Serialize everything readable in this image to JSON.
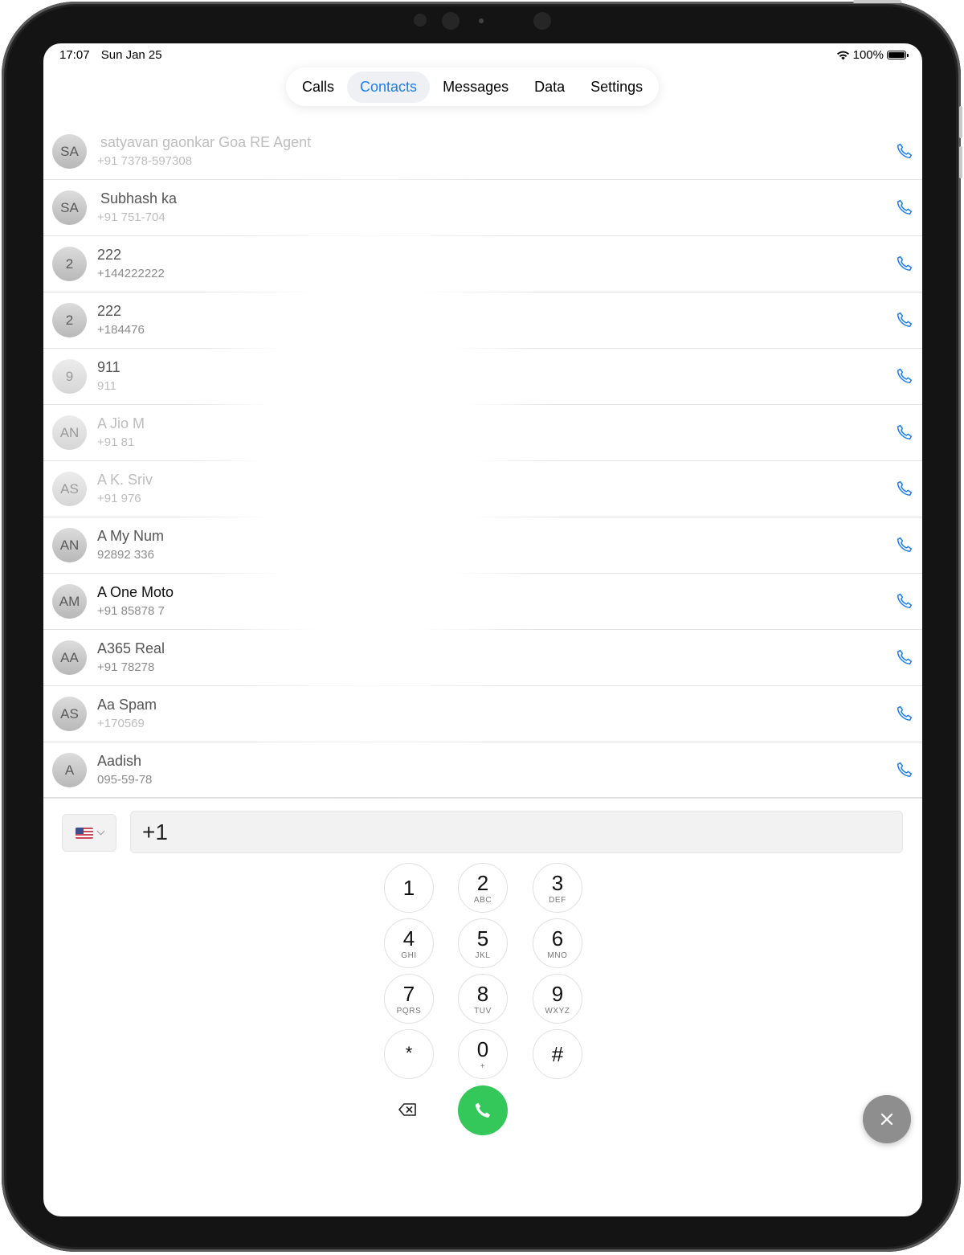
{
  "status_bar": {
    "time": "17:07",
    "date": "Sun Jan 25",
    "battery": "100%"
  },
  "tabs": [
    {
      "label": "Calls",
      "active": false
    },
    {
      "label": "Contacts",
      "active": true
    },
    {
      "label": "Messages",
      "active": false
    },
    {
      "label": "Data",
      "active": false
    },
    {
      "label": "Settings",
      "active": false
    }
  ],
  "contacts": [
    {
      "initials": "SA",
      "name": "satyavan gaonkar Goa RE Agent",
      "number": "+91 7378-597308"
    },
    {
      "initials": "SA",
      "name": "Subhash ka",
      "number": "+91 751-704"
    },
    {
      "initials": "2",
      "name": "222",
      "number": "+144222222"
    },
    {
      "initials": "2",
      "name": "222",
      "number": "+184476"
    },
    {
      "initials": "9",
      "name": "911",
      "number": "911"
    },
    {
      "initials": "AN",
      "name": "A Jio M",
      "number": "+91 81"
    },
    {
      "initials": "AS",
      "name": "A K. Sriv",
      "number": "+91 976"
    },
    {
      "initials": "AN",
      "name": "A My Num",
      "number": "92892 336"
    },
    {
      "initials": "AM",
      "name": "A One Moto",
      "number": "+91 85878 7"
    },
    {
      "initials": "AA",
      "name": "A365 Real",
      "number": "+91 78278"
    },
    {
      "initials": "AS",
      "name": "Aa Spam",
      "number": "+170569"
    },
    {
      "initials": "A",
      "name": "Aadish",
      "number": "095-59-78"
    }
  ],
  "dialer": {
    "country_flag": "us-flag-icon",
    "number_value": "+1",
    "keys": [
      {
        "digit": "1",
        "letters": ""
      },
      {
        "digit": "2",
        "letters": "ABC"
      },
      {
        "digit": "3",
        "letters": "DEF"
      },
      {
        "digit": "4",
        "letters": "GHI"
      },
      {
        "digit": "5",
        "letters": "JKL"
      },
      {
        "digit": "6",
        "letters": "MNO"
      },
      {
        "digit": "7",
        "letters": "PQRS"
      },
      {
        "digit": "8",
        "letters": "TUV"
      },
      {
        "digit": "9",
        "letters": "WXYZ"
      },
      {
        "digit": "*",
        "letters": ""
      },
      {
        "digit": "0",
        "letters": "+"
      },
      {
        "digit": "#",
        "letters": ""
      }
    ]
  },
  "colors": {
    "accent": "#1a7ef0",
    "call_green": "#34c759",
    "fab_gray": "#8e8e8e"
  }
}
